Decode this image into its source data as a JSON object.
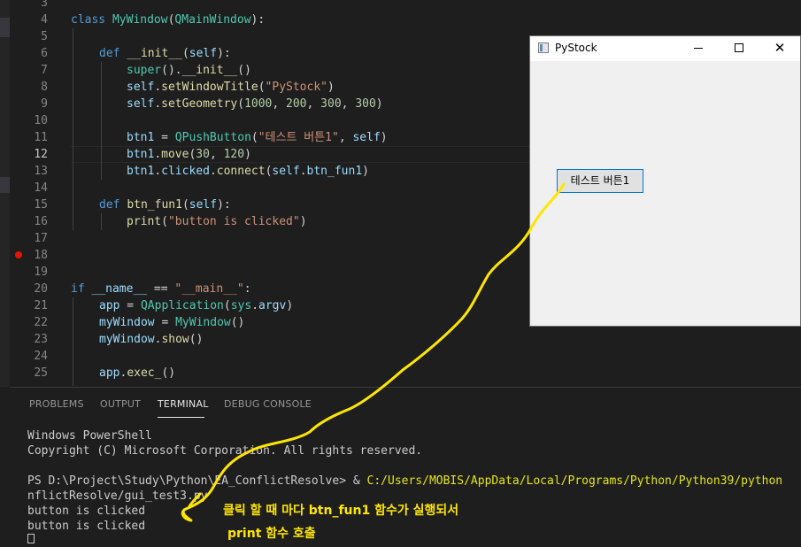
{
  "editor": {
    "line_numbers": [
      "3",
      "4",
      "5",
      "6",
      "7",
      "8",
      "9",
      "10",
      "11",
      "12",
      "13",
      "14",
      "15",
      "16",
      "17",
      "18",
      "19",
      "20",
      "21",
      "22",
      "23",
      "24",
      "25"
    ],
    "active_line": "12",
    "code": {
      "l4": [
        "class ",
        "MyWindow",
        "(",
        "QMainWindow",
        "):"
      ],
      "l6": [
        "def ",
        "__init__",
        "(",
        "self",
        "):"
      ],
      "l7": [
        "super",
        "().",
        "__init__",
        "()"
      ],
      "l8": [
        "self",
        ".",
        "setWindowTitle",
        "(",
        "\"PyStock\"",
        ")"
      ],
      "l9": [
        "self",
        ".",
        "setGeometry",
        "(",
        "1000",
        ", ",
        "200",
        ", ",
        "300",
        ", ",
        "300",
        ")"
      ],
      "l11": [
        "btn1",
        " = ",
        "QPushButton",
        "(",
        "\"테스트 버튼1\"",
        ", ",
        "self",
        ")"
      ],
      "l12": [
        "btn1",
        ".",
        "move",
        "(",
        "30",
        ", ",
        "120",
        ")"
      ],
      "l13": [
        "btn1",
        ".",
        "clicked",
        ".",
        "connect",
        "(",
        "self",
        ".",
        "btn_fun1",
        ")"
      ],
      "l15": [
        "def ",
        "btn_fun1",
        "(",
        "self",
        "):"
      ],
      "l16": [
        "print",
        "(",
        "\"button is clicked\"",
        ")"
      ],
      "l20": [
        "if ",
        "__name__",
        " == ",
        "\"__main__\"",
        ":"
      ],
      "l21": [
        "app",
        " = ",
        "QApplication",
        "(",
        "sys",
        ".",
        "argv",
        ")"
      ],
      "l22": [
        "myWindow",
        " = ",
        "MyWindow",
        "()"
      ],
      "l23": [
        "myWindow",
        ".",
        "show",
        "()"
      ],
      "l25": [
        "app",
        ".",
        "exec_",
        "()"
      ]
    }
  },
  "panel": {
    "tabs": [
      "PROBLEMS",
      "OUTPUT",
      "TERMINAL",
      "DEBUG CONSOLE"
    ],
    "active_tab": "TERMINAL",
    "terminal": {
      "line1": "Windows PowerShell",
      "line2": "Copyright (C) Microsoft Corporation. All rights reserved.",
      "prompt": "PS D:\\Project\\Study\\Python\\EA_ConflictResolve> & ",
      "cmd_path": "C:/Users/MOBIS/AppData/Local/Programs/Python/Python39/python",
      "line4": "nflictResolve/gui_test3.py",
      "line5": "button is clicked",
      "line6": "button is clicked"
    }
  },
  "qt_window": {
    "title": "PyStock",
    "button_label": "테스트 버튼1",
    "close_glyph": "✕"
  },
  "annotation": {
    "line1": "클릭 할 때 마다 btn_fun1 함수가 실행되서",
    "line2": "print 함수 호출",
    "color": "#ffe600"
  }
}
